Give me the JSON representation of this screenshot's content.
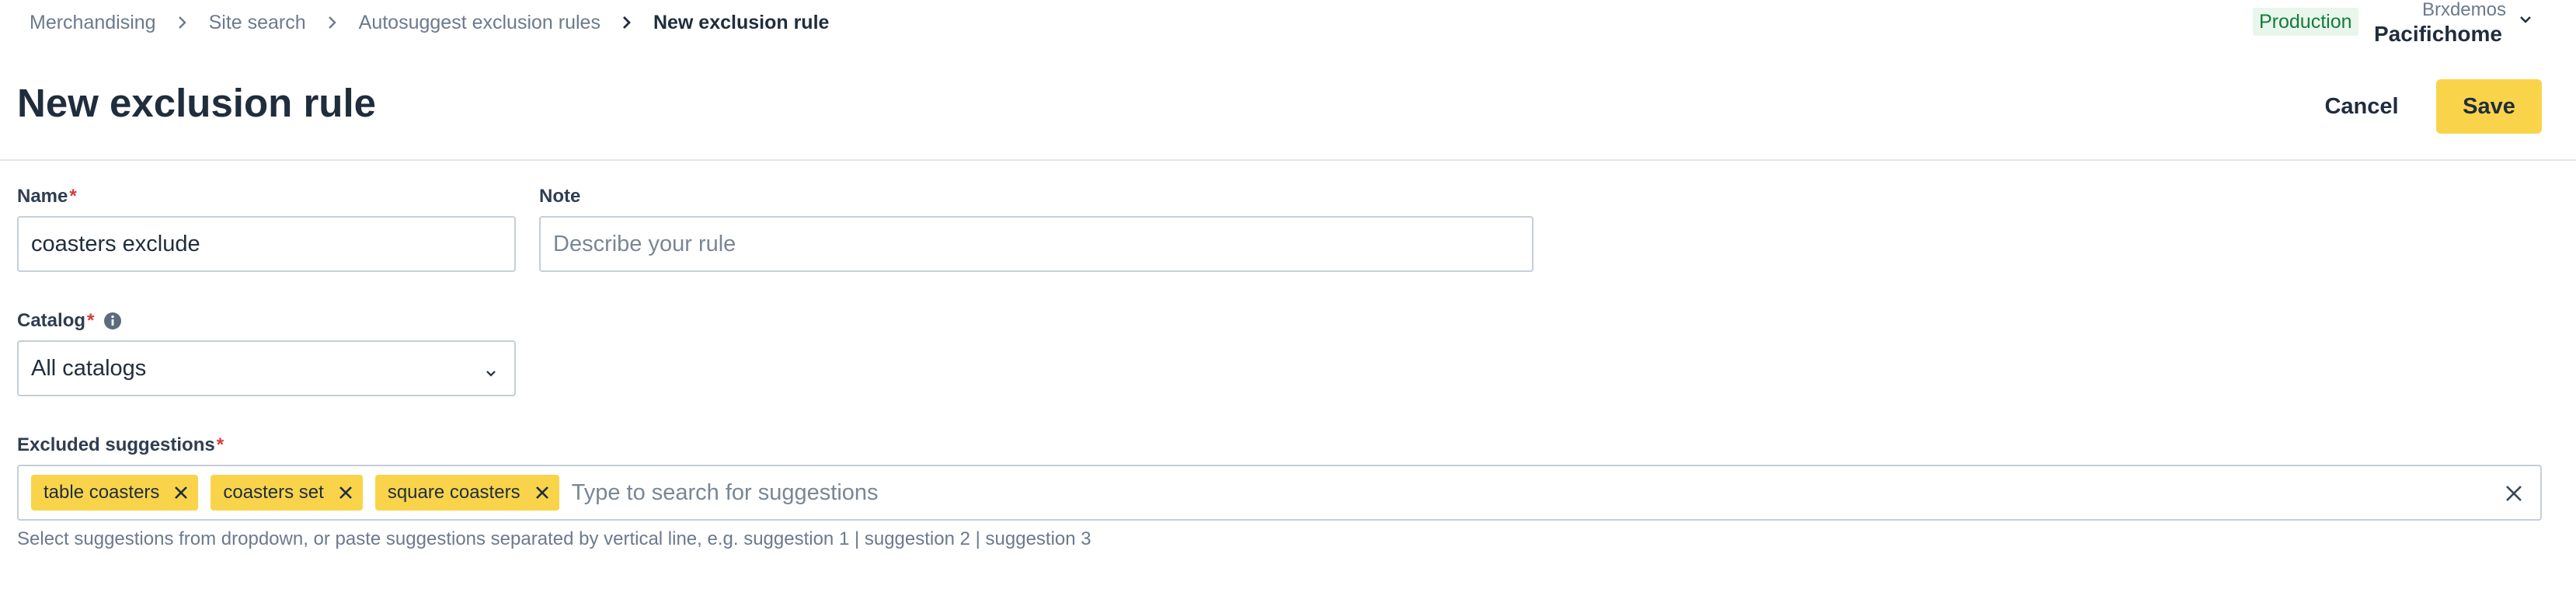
{
  "breadcrumb": [
    "Merchandising",
    "Site search",
    "Autosuggest exclusion rules"
  ],
  "breadcrumb_current": "New exclusion rule",
  "environment": "Production",
  "account": {
    "org": "Brxdemos",
    "name": "Pacifichome"
  },
  "page_title": "New exclusion rule",
  "actions": {
    "cancel": "Cancel",
    "save": "Save"
  },
  "form": {
    "name": {
      "label": "Name",
      "required_mark": "*",
      "value": "coasters exclude"
    },
    "note": {
      "label": "Note",
      "placeholder": "Describe your rule"
    },
    "catalog": {
      "label": "Catalog",
      "required_mark": "*",
      "value": "All catalogs",
      "info_icon": "info-circle-icon"
    },
    "excluded": {
      "label": "Excluded suggestions",
      "required_mark": "*",
      "tags": [
        "table coasters",
        "coasters set",
        "square coasters"
      ],
      "placeholder": "Type to search for suggestions",
      "hint": "Select suggestions from dropdown, or paste suggestions separated by vertical line, e.g. suggestion 1 | suggestion 2 | suggestion 3"
    }
  },
  "colors": {
    "accent": "#f9d44a",
    "required": "#d93a3a",
    "env_badge_bg": "#e8f6ec",
    "env_badge_text": "#177a3c",
    "border": "#c5ced9"
  }
}
